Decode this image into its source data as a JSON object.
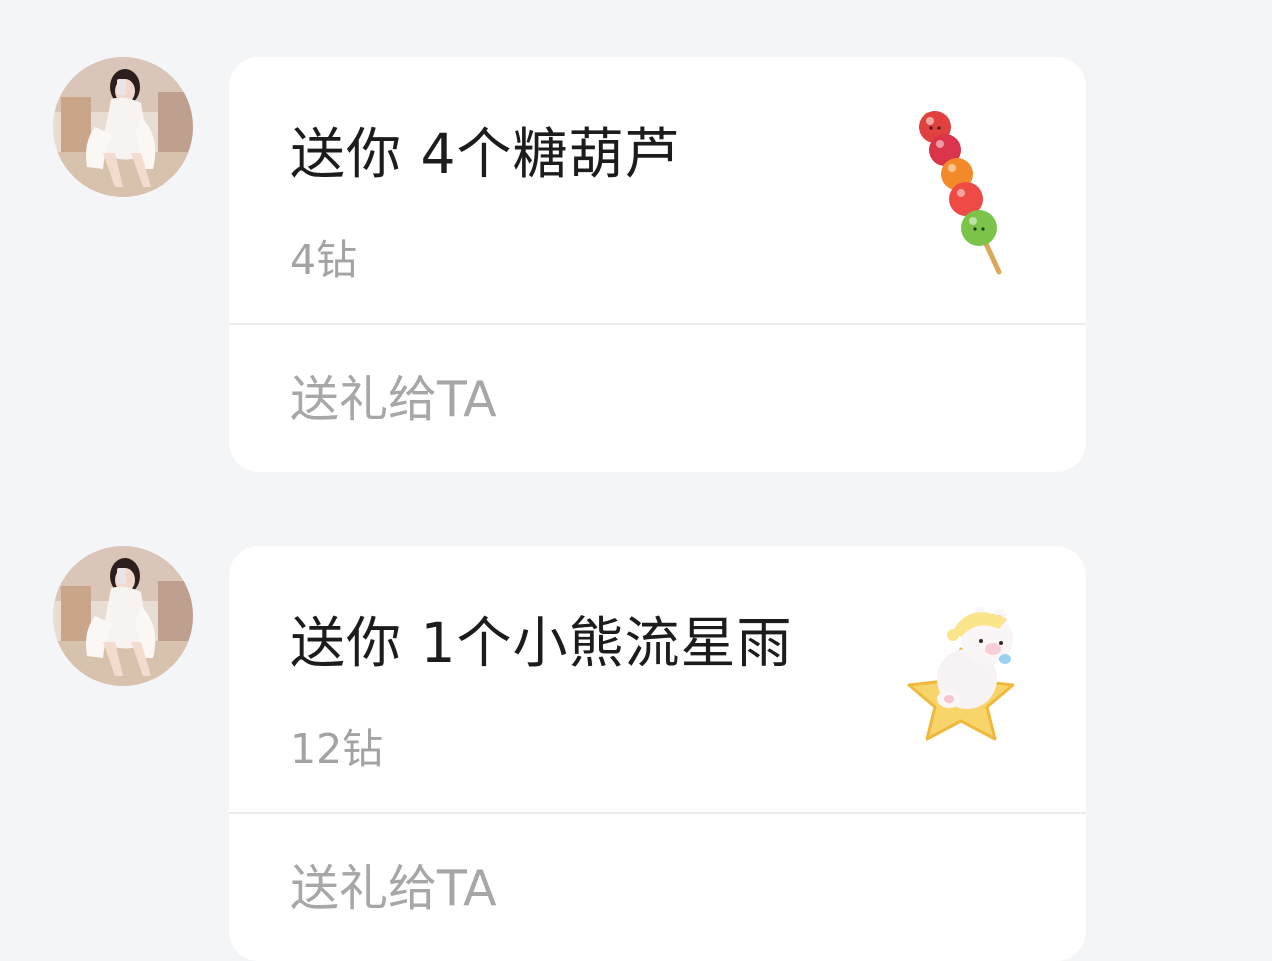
{
  "messages": [
    {
      "gift_title": "送你 4个糖葫芦",
      "gift_price": "4钻",
      "gift_icon": "candied-haws-icon",
      "action_label": "送礼给TA"
    },
    {
      "gift_title": "送你 1个小熊流星雨",
      "gift_price": "12钻",
      "gift_icon": "bear-meteor-shower-icon",
      "action_label": "送礼给TA"
    }
  ],
  "colors": {
    "background": "#f4f5f7",
    "card": "#ffffff",
    "title_text": "#1c1c1c",
    "secondary_text": "#a3a3a3",
    "divider": "#ececec"
  }
}
